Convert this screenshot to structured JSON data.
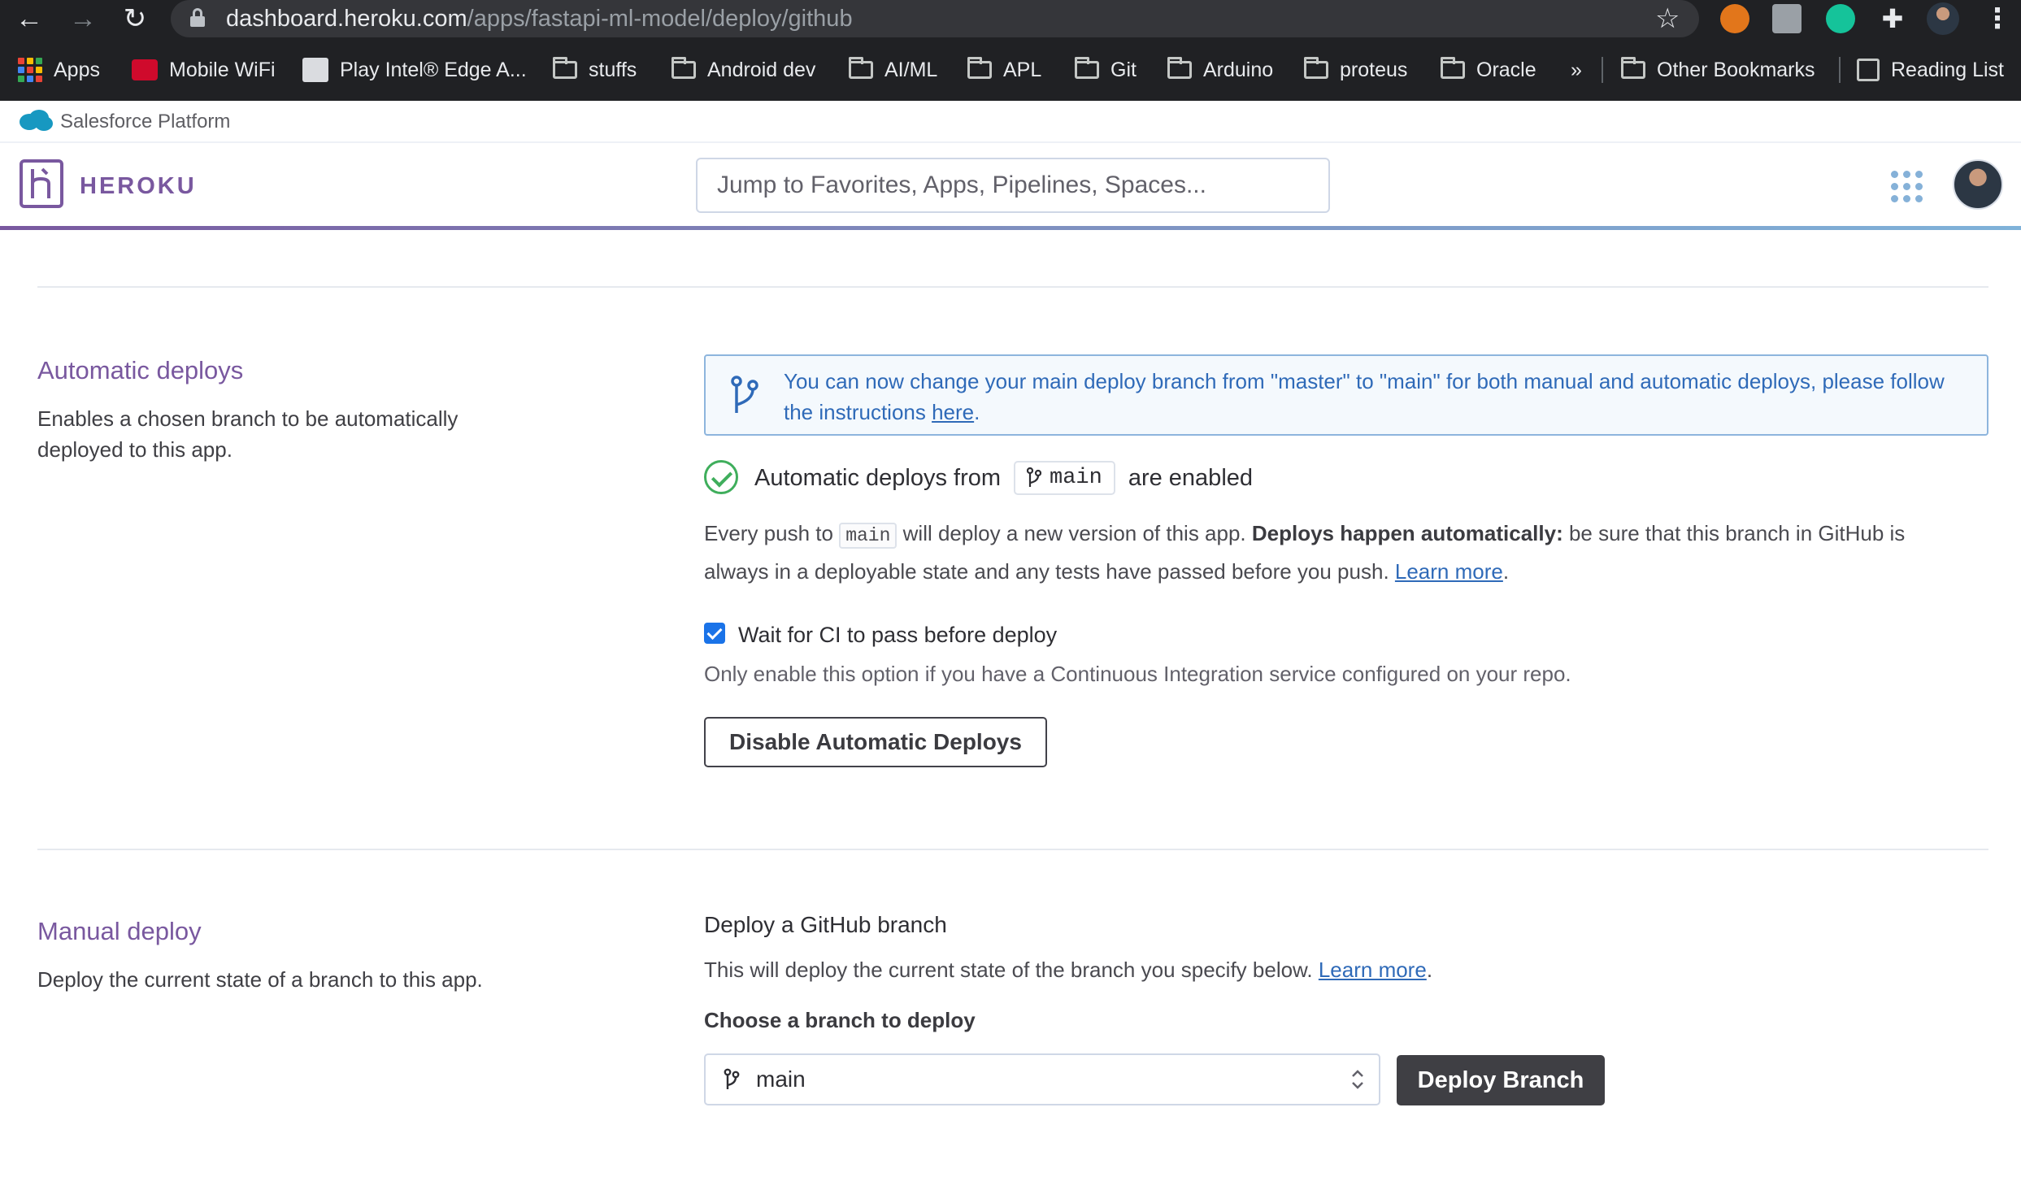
{
  "browser": {
    "url_host": "dashboard.heroku.com",
    "url_path": "/apps/fastapi-ml-model/deploy/github",
    "bookmarks": [
      {
        "label": "Apps",
        "icon": "apps-grid-icon"
      },
      {
        "label": "Mobile WiFi",
        "icon": "huawei-icon"
      },
      {
        "label": "Play Intel® Edge A...",
        "icon": "cloud-page-icon"
      },
      {
        "label": "stuffs",
        "icon": "folder-icon"
      },
      {
        "label": "Android dev",
        "icon": "folder-icon"
      },
      {
        "label": "AI/ML",
        "icon": "folder-icon"
      },
      {
        "label": "APL",
        "icon": "folder-icon"
      },
      {
        "label": "Git",
        "icon": "folder-icon"
      },
      {
        "label": "Arduino",
        "icon": "folder-icon"
      },
      {
        "label": "proteus",
        "icon": "folder-icon"
      },
      {
        "label": "Oracle",
        "icon": "folder-icon"
      }
    ],
    "overflow_label": "»",
    "other_bookmarks": "Other Bookmarks",
    "reading_list": "Reading List"
  },
  "salesforce": {
    "label": "Salesforce Platform"
  },
  "header": {
    "brand": "HEROKU",
    "search_placeholder": "Jump to Favorites, Apps, Pipelines, Spaces..."
  },
  "automatic": {
    "title": "Automatic deploys",
    "description": "Enables a chosen branch to be automatically deployed to this app.",
    "notice_text": "You can now change your main deploy branch from \"master\" to \"main\" for both manual and automatic deploys, please follow the instructions ",
    "notice_link": "here",
    "notice_end": ".",
    "status_prefix": "Automatic deploys from",
    "branch": "main",
    "status_suffix": "are enabled",
    "para_1": "Every push to ",
    "para_code": "main",
    "para_2": " will deploy a new version of this app. ",
    "para_bold": "Deploys happen automatically:",
    "para_3": " be sure that this branch in GitHub is always in a deployable state and any tests have passed before you push. ",
    "para_link": "Learn more",
    "para_end": ".",
    "ci_checked": true,
    "ci_label": "Wait for CI to pass before deploy",
    "ci_help": "Only enable this option if you have a Continuous Integration service configured on your repo.",
    "disable_button": "Disable Automatic Deploys"
  },
  "manual": {
    "title": "Manual deploy",
    "description": "Deploy the current state of a branch to this app.",
    "deploy_title": "Deploy a GitHub branch",
    "deploy_desc": "This will deploy the current state of the branch you specify below. ",
    "deploy_link": "Learn more",
    "deploy_end": ".",
    "choose_label": "Choose a branch to deploy",
    "selected_branch": "main",
    "deploy_button": "Deploy Branch"
  },
  "colors": {
    "accent": "#79589f",
    "info": "#2f6ab8",
    "success": "#3fae5c",
    "button_dark": "#3f3f44"
  }
}
